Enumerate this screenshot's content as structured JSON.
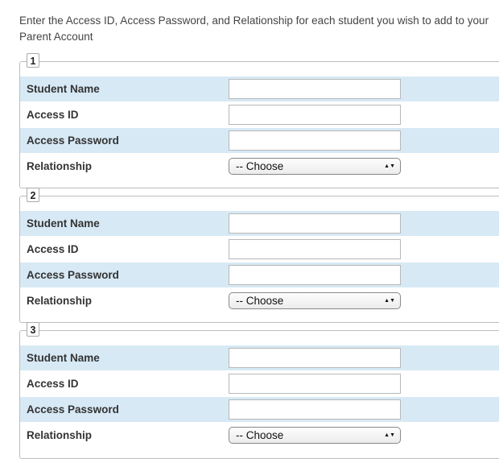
{
  "intro": "Enter the Access ID, Access Password, and Relationship for each student you wish to add to your Parent Account",
  "labels": {
    "student_name": "Student Name",
    "access_id": "Access ID",
    "access_password": "Access Password",
    "relationship": "Relationship"
  },
  "groups": [
    {
      "number": "1",
      "student_name": "",
      "access_id": "",
      "access_password": "",
      "relationship": "-- Choose"
    },
    {
      "number": "2",
      "student_name": "",
      "access_id": "",
      "access_password": "",
      "relationship": "-- Choose"
    },
    {
      "number": "3",
      "student_name": "",
      "access_id": "",
      "access_password": "",
      "relationship": "-- Choose"
    }
  ],
  "colors": {
    "row_shade": "#d7e9f5",
    "border": "#bdbdbd"
  },
  "icons": {
    "select_arrow": "up-down-arrows-icon"
  }
}
